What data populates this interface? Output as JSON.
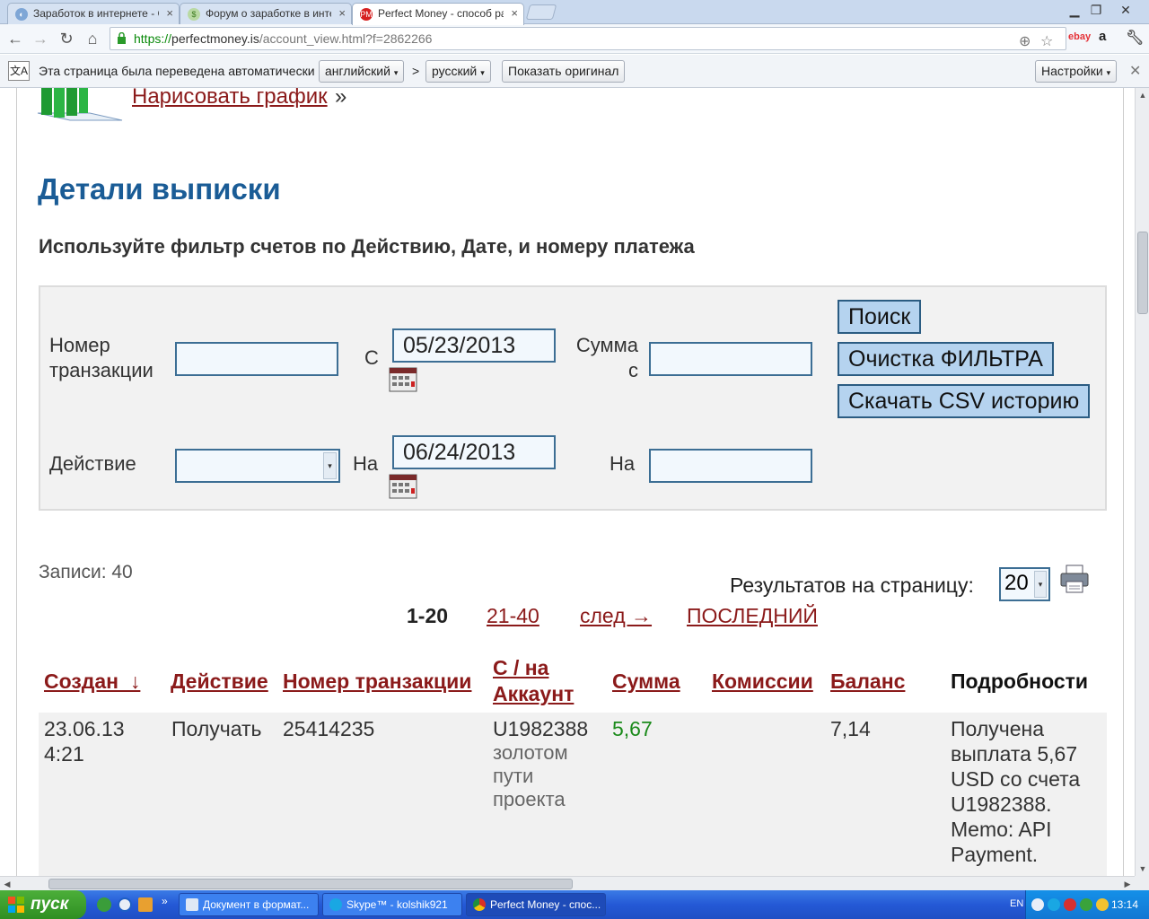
{
  "browser": {
    "tabs": [
      {
        "title": "Заработок в интернете - С"
      },
      {
        "title": "Форум о заработке в интер"
      },
      {
        "title": "Perfect Money - способ раз"
      }
    ],
    "url": {
      "scheme": "https://",
      "host": "perfectmoney.is",
      "path": "/account_view.html?f=2862266"
    },
    "translate_bar": {
      "label": "Эта страница была переведена автоматически",
      "from_language": "английский",
      "arrow": ">",
      "to_language": "русский",
      "show_original": "Показать оригинал",
      "settings": "Настройки"
    }
  },
  "page": {
    "draw_chart_link": "Нарисовать график",
    "draw_chart_suffix": "»",
    "title": "Детали выписки",
    "filter_hint": "Используйте фильтр счетов по Действию, Дате, и номеру платежа",
    "filter": {
      "transaction_label_1": "Номер",
      "transaction_label_2": "транзакции",
      "from_label": "С",
      "date_from": "05/23/2013",
      "amount_label_1": "Сумма",
      "amount_label_2": "с",
      "action_label": "Действие",
      "to_label": "На",
      "date_to": "06/24/2013",
      "amount_to_label": "На",
      "search_button": "Поиск",
      "clear_button": "Очистка ФИЛЬТРА",
      "csv_button": "Скачать CSV историю"
    },
    "records_label": "Записи: 40",
    "per_page_label": "Результатов на страницу:",
    "per_page_value": "20",
    "pager": {
      "current": "1-20",
      "next_range": "21-40",
      "next": "след →",
      "last": "ПОСЛЕДНИЙ"
    },
    "table": {
      "headers": {
        "created": "Создан_↓",
        "action": "Действие",
        "transaction": "Номер транзакции",
        "account_1": "С / на",
        "account_2": "Аккаунт",
        "amount": "Сумма",
        "fees": "Комиссии",
        "balance": "Баланс",
        "details": "Подробности"
      },
      "rows": [
        {
          "date": "23.06.13",
          "time": "4:21",
          "action": "Получать",
          "transaction": "25414235",
          "account": "U1982388",
          "account_note_1": "золотом",
          "account_note_2": "пути",
          "account_note_3": "проекта",
          "amount": "5,67",
          "fees": "",
          "balance": "7,14",
          "details_1": "Получена",
          "details_2": "выплата 5,67",
          "details_3": "USD со счета",
          "details_4": "U1982388.",
          "details_5": "Memo: API",
          "details_6": "Payment."
        }
      ]
    }
  },
  "taskbar": {
    "start": "пуск",
    "tasks": [
      {
        "title": "Документ в формат..."
      },
      {
        "title": "Skype™ - kolshik921"
      },
      {
        "title": "Perfect Money - спос..."
      }
    ],
    "language": "EN",
    "clock": "13:14"
  },
  "colors": {
    "link": "#8b1a1a",
    "title": "#1a5c96",
    "amount_positive": "#1a8a1a",
    "button": "#b5d3ef"
  }
}
